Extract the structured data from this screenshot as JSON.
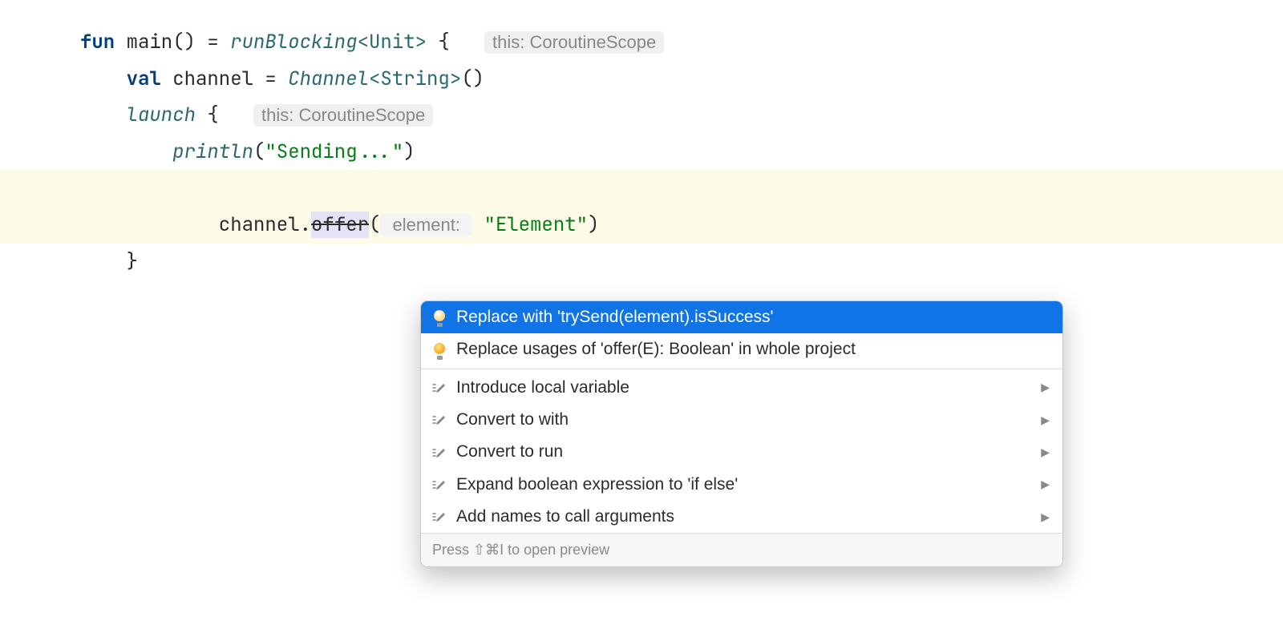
{
  "code": {
    "line1_fun": "fun",
    "line1_main": " main() = ",
    "line1_runblocking": "runBlocking",
    "line1_type": "<Unit>",
    "line1_brace": " {",
    "line1_hint": "this: CoroutineScope",
    "line2_val": "    val",
    "line2_channel": " channel = ",
    "line2_Channel": "Channel",
    "line2_type": "<String>",
    "line2_paren": "()",
    "line3_launch": "    launch",
    "line3_brace": " {",
    "line3_hint": "this: CoroutineScope",
    "line4_println": "        println",
    "line4_paren1": "(",
    "line4_str": "\"Sending...\"",
    "line4_paren2": ")",
    "line5_prefix": "        channel.",
    "line5_offer": "offer",
    "line5_paren1": "(",
    "line5_paramhint": " element: ",
    "line5_str": "\"Element\"",
    "line5_paren2": ")",
    "line6": "    }"
  },
  "popup": {
    "items": [
      {
        "label": "Replace with 'trySend(element).isSuccess'",
        "icon": "bulb",
        "selected": true,
        "submenu": false
      },
      {
        "label": "Replace usages of 'offer(E): Boolean' in whole project",
        "icon": "bulb",
        "selected": false,
        "submenu": false
      }
    ],
    "items2": [
      {
        "label": "Introduce local variable",
        "icon": "pencil",
        "submenu": true
      },
      {
        "label": "Convert to with",
        "icon": "pencil",
        "submenu": true
      },
      {
        "label": "Convert to run",
        "icon": "pencil",
        "submenu": true
      },
      {
        "label": "Expand boolean expression to 'if else'",
        "icon": "pencil",
        "submenu": true
      },
      {
        "label": "Add names to call arguments",
        "icon": "pencil",
        "submenu": true
      }
    ],
    "footer": "Press ⇧⌘I to open preview"
  }
}
